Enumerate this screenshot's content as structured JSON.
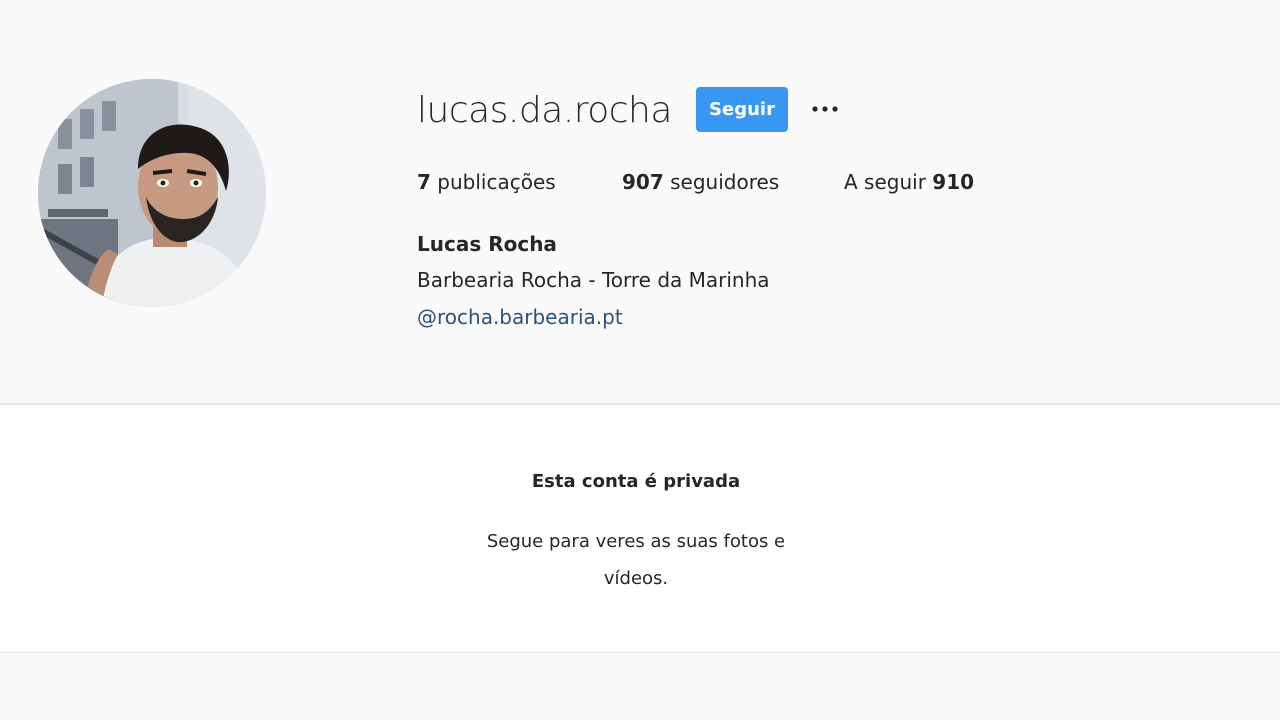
{
  "profile": {
    "username": "lucas.da.rocha",
    "follow_label": "Seguir",
    "more_icon": "more-horizontal-icon",
    "avatar_icon": "profile-photo",
    "stats": {
      "posts_count": "7",
      "posts_label": "publicações",
      "followers_count": "907",
      "followers_label": "seguidores",
      "following_label": "A seguir",
      "following_count": "910"
    },
    "full_name": "Lucas Rocha",
    "bio": "Barbearia Rocha - Torre da Marinha",
    "bio_link": "@rocha.barbearia.pt"
  },
  "private_notice": {
    "title": "Esta conta é privada",
    "message": "Segue para veres as suas fotos e vídeos."
  },
  "colors": {
    "accent": "#3897f0",
    "link": "#2b5278",
    "background": "#fafafa",
    "panel": "#ffffff"
  }
}
